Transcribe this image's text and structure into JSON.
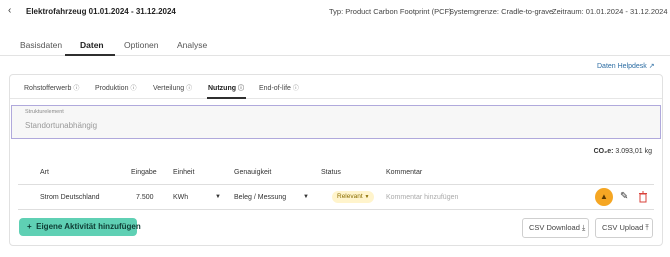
{
  "header": {
    "title": "Elektrofahrzeug 01.01.2024 - 31.12.2024",
    "meta": [
      {
        "label": "Typ:",
        "value": "Product Carbon Footprint (PCF)"
      },
      {
        "label": "Systemgrenze:",
        "value": "Cradle-to-grave"
      },
      {
        "label": "Zeitraum:",
        "value": "01.01.2024 - 31.12.2024"
      }
    ]
  },
  "tabs": [
    "Basisdaten",
    "Daten",
    "Optionen",
    "Analyse"
  ],
  "active_tab": "Daten",
  "helpdesk_label": "Daten Helpdesk",
  "subtabs": [
    "Rohstofferwerb",
    "Produktion",
    "Verteilung",
    "Nutzung",
    "End-of-life"
  ],
  "active_subtab": "Nutzung",
  "struct_field": {
    "label": "Strukturelement",
    "value": "Standortunabhängig"
  },
  "co2": {
    "label": "CO₂e:",
    "value": "3.093,01 kg"
  },
  "table": {
    "headers": [
      "Art",
      "Eingabe",
      "Einheit",
      "Genauigkeit",
      "Status",
      "Kommentar"
    ],
    "rows": [
      {
        "art": "Strom Deutschland",
        "eingabe": "7.500",
        "einheit": "KWh",
        "genauigkeit": "Beleg / Messung",
        "status": "Relevant",
        "kommentar_placeholder": "Kommentar hinzufügen"
      }
    ]
  },
  "buttons": {
    "add": "Eigene Aktivität hinzufügen",
    "csv_download": "CSV Download",
    "csv_upload": "CSV Upload"
  },
  "colors": {
    "accent": "#5fd0b4",
    "badge_bg": "#fff4cc",
    "action_orange": "#f5a623",
    "delete_red": "#d9403a",
    "link": "#2b6ca3"
  }
}
